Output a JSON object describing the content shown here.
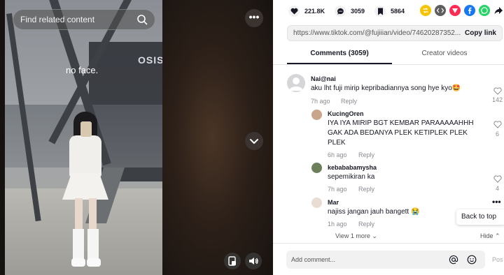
{
  "video": {
    "search_placeholder": "Find related content",
    "caption": "no face.",
    "sign_text": "OSIS",
    "more_label": "•••"
  },
  "stats": {
    "likes": "221.8K",
    "comments": "3059",
    "saves": "5864"
  },
  "share_icons": [
    {
      "name": "repost-icon",
      "color": "#f5c400"
    },
    {
      "name": "embed-icon",
      "color": "#5e5e5e"
    },
    {
      "name": "send-icon",
      "color": "#fe2c55"
    },
    {
      "name": "facebook-icon",
      "color": "#1877f2"
    },
    {
      "name": "whatsapp-icon",
      "color": "#25d366"
    }
  ],
  "link": {
    "url": "https://www.tiktok.com/@fujiiian/video/74620287352...",
    "copy_label": "Copy link"
  },
  "tabs": {
    "comments": "Comments (3059)",
    "creator": "Creator videos"
  },
  "comments": [
    {
      "user": "Nai@nai",
      "text": "aku lht fuji mirip kepribadiannya song hye kyo🤩",
      "time": "7h ago",
      "reply": "Reply",
      "likes": "142"
    },
    {
      "user": "KucingOren",
      "text": "IYA IYA MIRIP BGT KEMBAR PARAAAAAHHH GAK ADA BEDANYA PLEK KETIPLEK PLEK PLEK",
      "time": "6h ago",
      "reply": "Reply",
      "likes": "6"
    },
    {
      "user": "kebababamysha",
      "text": "sepemikiran ka",
      "time": "7h ago",
      "reply": "Reply",
      "likes": "4"
    },
    {
      "user": "Mar",
      "text": "najiss jangan jauh bangett 😭",
      "time": "1h ago",
      "reply": "Reply",
      "likes": ""
    }
  ],
  "back_to_top": "Back to top",
  "view_more": "View 1 more ⌄",
  "hide": "Hide ⌃",
  "comment_input": {
    "placeholder": "Add comment...",
    "post_label": "Pos"
  }
}
